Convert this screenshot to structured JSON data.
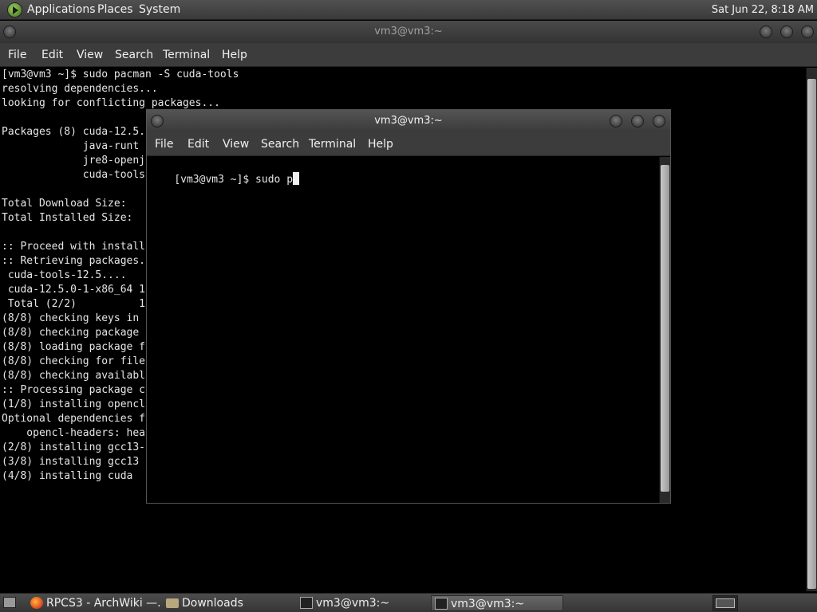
{
  "top_panel": {
    "menus": [
      "Applications",
      "Places",
      "System"
    ],
    "clock": "Sat Jun 22,  8:18 AM"
  },
  "back_window": {
    "title": "vm3@vm3:~",
    "menu": [
      "File",
      "Edit",
      "View",
      "Search",
      "Terminal",
      "Help"
    ],
    "lines": [
      "[vm3@vm3 ~]$ sudo pacman -S cuda-tools",
      "resolving dependencies...",
      "looking for conflicting packages...",
      "",
      "Packages (8) cuda-12.5.",
      "             java-runt",
      "             jre8-openj",
      "             cuda-tools",
      "",
      "Total Download Size:",
      "Total Installed Size:",
      "",
      ":: Proceed with install",
      ":: Retrieving packages.",
      " cuda-tools-12.5....",
      " cuda-12.5.0-1-x86_64 1",
      " Total (2/2)          1",
      "(8/8) checking keys in",
      "(8/8) checking package",
      "(8/8) loading package f",
      "(8/8) checking for file",
      "(8/8) checking availabl",
      ":: Processing package c",
      "(1/8) installing opencl",
      "Optional dependencies f",
      "    opencl-headers: hea",
      "(2/8) installing gcc13-",
      "(3/8) installing gcc13",
      "(4/8) installing cuda"
    ]
  },
  "front_window": {
    "title": "vm3@vm3:~",
    "menu": [
      "File",
      "Edit",
      "View",
      "Search",
      "Terminal",
      "Help"
    ],
    "prompt": "[vm3@vm3 ~]$ sudo p"
  },
  "taskbar": {
    "tasks": [
      {
        "label": "RPCS3 - ArchWiki —...",
        "icon": "firefox-icon"
      },
      {
        "label": "Downloads",
        "icon": "folder-icon"
      },
      {
        "label": "vm3@vm3:~",
        "icon": "terminal-icon"
      },
      {
        "label": "vm3@vm3:~",
        "icon": "terminal-icon"
      }
    ]
  },
  "colors": {
    "terminal_bg": "#000000",
    "panel_bg": "#444444",
    "text": "#e6e6e6"
  }
}
